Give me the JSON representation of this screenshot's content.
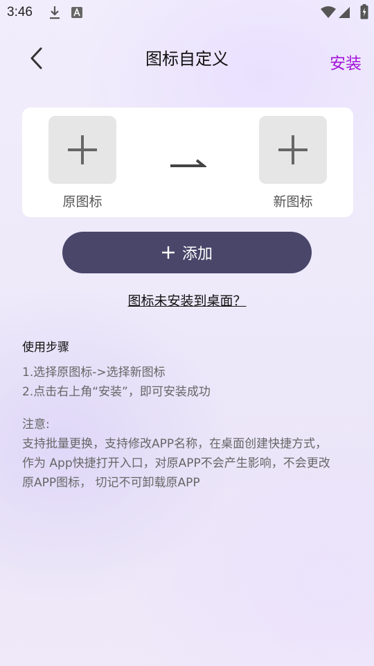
{
  "status_bar": {
    "time": "3:46",
    "icons": [
      "download-icon",
      "font-a-icon",
      "wifi-icon",
      "signal-icon",
      "battery-icon"
    ]
  },
  "header": {
    "title": "图标自定义",
    "back_icon": "chevron-left-icon",
    "install_label": "安装",
    "install_color": "#a313d8"
  },
  "card": {
    "original_label": "原图标",
    "new_label": "新图标",
    "slot_icon": "plus-icon",
    "arrow_icon": "arrow-right-icon"
  },
  "add_button": {
    "label": "添加",
    "color": "#4a466a"
  },
  "link": {
    "text": "图标未安装到桌面？"
  },
  "instructions": {
    "title": "使用步骤",
    "steps": [
      "1.选择原图标->选择新图标",
      "2.点击右上角“安装”，即可安装成功"
    ],
    "note_title": "注意:",
    "notes": [
      "支持批量更换，支持修改APP名称，在桌面创建快捷方式，",
      "作为 App快捷打开入口，对原APP不会产生影响，不会更改",
      "原APP图标， 切记不可卸载原APP"
    ]
  }
}
